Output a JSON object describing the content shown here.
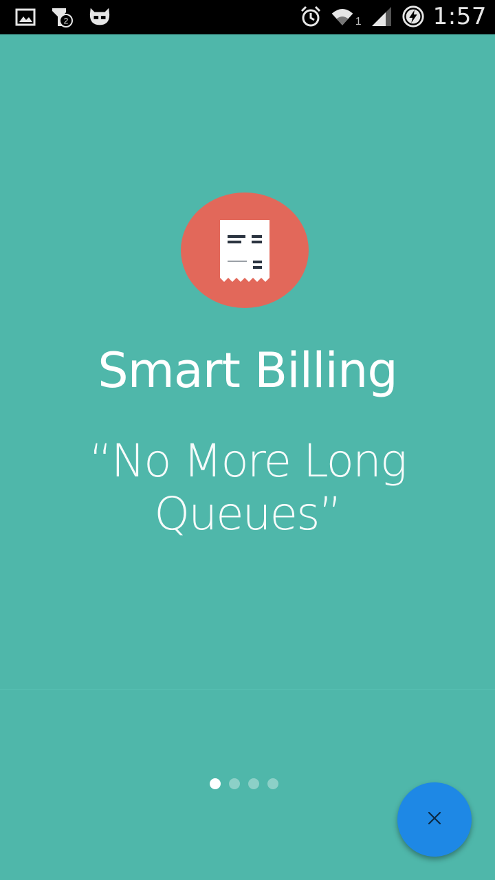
{
  "status_bar": {
    "time": "1:57",
    "notification_count": "2",
    "sim_slot": "1",
    "icons": [
      "image-icon",
      "notification-badge-icon",
      "cyanogen-icon",
      "alarm-icon",
      "wifi-icon",
      "signal-icon",
      "battery-charging-icon"
    ]
  },
  "onboarding": {
    "title": "Smart Billing",
    "tagline": "“No More Long Queues”",
    "logo_icon": "receipt-icon",
    "page_indicator": {
      "pages": 4,
      "current": 1
    }
  },
  "fab": {
    "icon": "close-icon"
  },
  "colors": {
    "background": "#4fb7aa",
    "logo_circle": "#e2685a",
    "fab": "#1e88e5",
    "status_bar": "#000000"
  }
}
